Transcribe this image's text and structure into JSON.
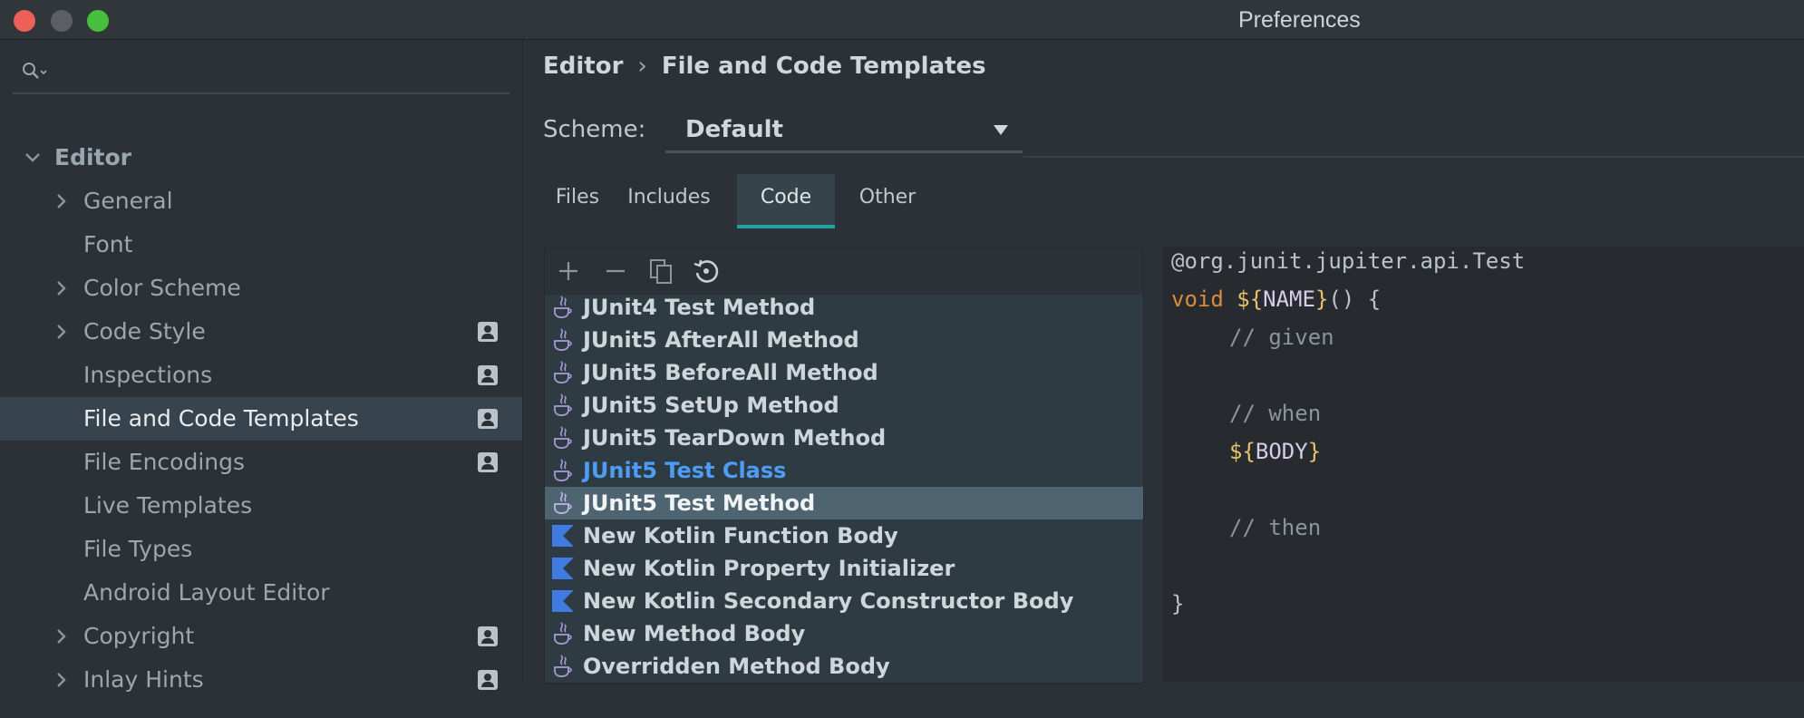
{
  "window": {
    "title": "Preferences"
  },
  "sidebar": {
    "search": {
      "value": "",
      "placeholder": ""
    },
    "items": [
      {
        "label": "Editor",
        "expanded": true
      },
      {
        "label": "General",
        "has_children": true
      },
      {
        "label": "Font"
      },
      {
        "label": "Color Scheme",
        "has_children": true
      },
      {
        "label": "Code Style",
        "has_children": true,
        "project_badge": true
      },
      {
        "label": "Inspections",
        "project_badge": true
      },
      {
        "label": "File and Code Templates",
        "project_badge": true,
        "selected": true
      },
      {
        "label": "File Encodings",
        "project_badge": true
      },
      {
        "label": "Live Templates"
      },
      {
        "label": "File Types"
      },
      {
        "label": "Android Layout Editor"
      },
      {
        "label": "Copyright",
        "has_children": true,
        "project_badge": true
      },
      {
        "label": "Inlay Hints",
        "has_children": true,
        "project_badge": true
      }
    ]
  },
  "breadcrumb": {
    "parent": "Editor",
    "separator": "›",
    "current": "File and Code Templates"
  },
  "scheme": {
    "label": "Scheme:",
    "value": "Default"
  },
  "tabs": [
    {
      "label": "Files"
    },
    {
      "label": "Includes"
    },
    {
      "label": "Code",
      "active": true
    },
    {
      "label": "Other"
    }
  ],
  "toolbar": {
    "add": "add-icon",
    "remove": "remove-icon",
    "copy": "copy-icon",
    "reset": "reset-icon"
  },
  "templates": [
    {
      "label": "JUnit4 Test Method",
      "icon": "java-icon"
    },
    {
      "label": "JUnit5 AfterAll Method",
      "icon": "java-icon"
    },
    {
      "label": "JUnit5 BeforeAll Method",
      "icon": "java-icon"
    },
    {
      "label": "JUnit5 SetUp Method",
      "icon": "java-icon"
    },
    {
      "label": "JUnit5 TearDown Method",
      "icon": "java-icon"
    },
    {
      "label": "JUnit5 Test Class",
      "icon": "java-icon",
      "modified": true
    },
    {
      "label": "JUnit5 Test Method",
      "icon": "java-icon",
      "selected": true
    },
    {
      "label": "New Kotlin Function Body",
      "icon": "kotlin-icon"
    },
    {
      "label": "New Kotlin Property Initializer",
      "icon": "kotlin-icon"
    },
    {
      "label": "New Kotlin Secondary Constructor Body",
      "icon": "kotlin-icon"
    },
    {
      "label": "New Method Body",
      "icon": "java-icon"
    },
    {
      "label": "Overridden Method Body",
      "icon": "java-icon"
    }
  ],
  "code": {
    "annotation": "@org.junit.jupiter.api.Test",
    "void_kw": "void",
    "name_open": "${",
    "name_var": "NAME",
    "name_close": "}",
    "sig_rest": "() {",
    "comment_given": "// given",
    "comment_when": "// when",
    "body_open": "${",
    "body_var": "BODY",
    "body_close": "}",
    "comment_then": "// then",
    "close_brace": "}"
  },
  "colors": {
    "accent": "#1fa39a",
    "selected_row": "#4e6470",
    "modified_text": "#4d9cf5",
    "keyword": "#d98c3e",
    "template_var": "#e8c06b"
  }
}
